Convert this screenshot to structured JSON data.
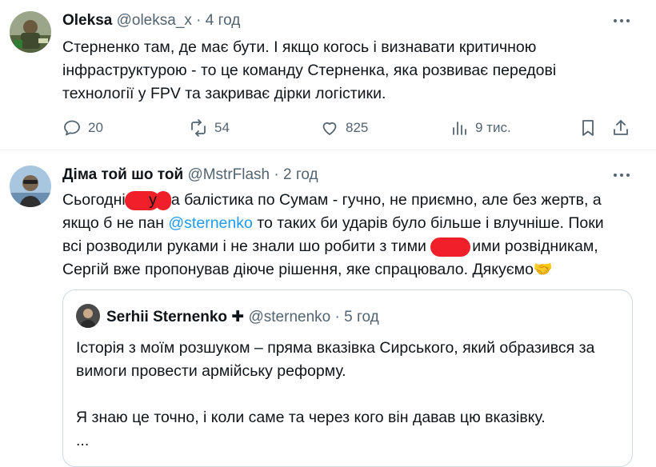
{
  "tweet1": {
    "author_name": "Oleksa",
    "handle": "@oleksa_x",
    "separator": "·",
    "time": "4 год",
    "lines": [
      "Стерненко там, де має бути. І якщо когось і визнавати критичною",
      "інфраструктурою - то це команду Стерненка, яка розвиває передові",
      "технології у FPV та закриває дірки логістики."
    ],
    "replies": "20",
    "reposts": "54",
    "likes": "825",
    "views": "9 тис."
  },
  "tweet2": {
    "author_name": "Діма той шо той",
    "handle": "@MstrFlash",
    "separator": "·",
    "time": "2 год",
    "line1_a": "Сьогодні ",
    "line1_b": "у",
    "line1_c": "а балістика по Сумам - гучно, не приємно, але без жертв, а",
    "line2_a": "якщо б не пан ",
    "line2_mention": "@sternenko",
    "line2_b": " то таких би ударів було більше і влучніше. Поки",
    "line3_a": "всі розводили руками і не знали шо робити з тими ",
    "line3_b": "ими розвідникам,",
    "line4": "Сергій вже пропонував діюче рішення, яке спрацювало. Дякуємо🤝"
  },
  "quote": {
    "author_name": "Serhii Sternenko",
    "cross": "✚",
    "handle": "@sternenko",
    "separator": "·",
    "time": "5 год",
    "lines": [
      "Історія з моїм розшуком – пряма вказівка Сирського, який образився за",
      "вимоги провести армійську реформу.",
      "",
      "Я знаю це точно, і коли саме та через кого він давав цю вказівку.",
      "..."
    ]
  },
  "colors": {
    "accent": "#1d9bf0",
    "muted": "#536471",
    "redaction": "#f0202a"
  }
}
